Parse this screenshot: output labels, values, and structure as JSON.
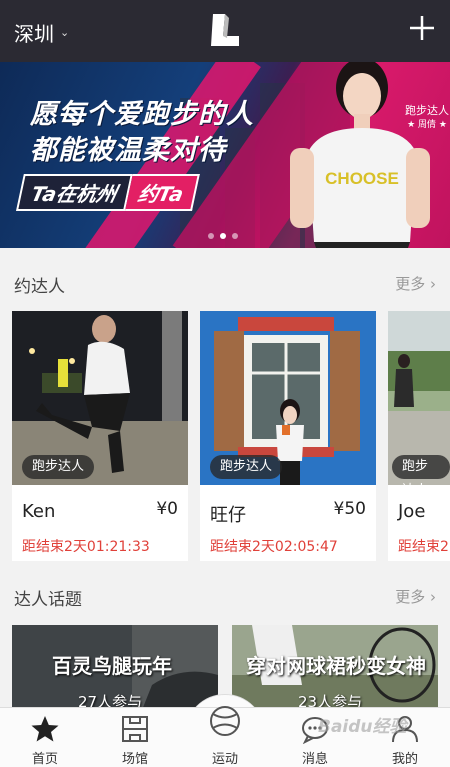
{
  "header": {
    "city": "深圳",
    "logo_icon": "brand-logo-icon",
    "add_icon": "plus-icon"
  },
  "banner": {
    "line1": "愿每个爱跑步的人",
    "line2": "都能被温柔对待",
    "tag_left": "Ta在杭州",
    "tag_right": "约Ta",
    "runner_label": "跑步达人",
    "runner_name": "★ 周倩 ★",
    "shirt_text": "CHOOSE",
    "carousel_active_index": 2,
    "carousel_count": 3
  },
  "section_people": {
    "title": "约达人",
    "more": "更多 ›"
  },
  "people": [
    {
      "badge": "跑步达人",
      "name": "Ken",
      "price": "¥0",
      "timer": "距结束2天01:21:33"
    },
    {
      "badge": "跑步达人",
      "name": "旺仔",
      "price": "¥50",
      "timer": "距结束2天02:05:47"
    },
    {
      "badge": "跑步达人",
      "name": "Joe",
      "price": "",
      "timer": "距结束2"
    }
  ],
  "section_topics": {
    "title": "达人话题",
    "more": "更多 ›"
  },
  "topics": [
    {
      "title": "百灵鸟腿玩年",
      "count": "27人参与"
    },
    {
      "title": "穿对网球裙秒变女神",
      "count": "23人参与"
    }
  ],
  "nav": [
    {
      "label": "首页",
      "icon": "star-icon",
      "active": true
    },
    {
      "label": "场馆",
      "icon": "venue-icon",
      "active": false
    },
    {
      "label": "运动",
      "icon": "ball-icon",
      "active": false
    },
    {
      "label": "消息",
      "icon": "message-icon",
      "active": false
    },
    {
      "label": "我的",
      "icon": "person-icon",
      "active": false
    }
  ],
  "watermark": "Baidu经验",
  "colors": {
    "header_bg": "#2b2a33",
    "accent_red": "#e0413a",
    "banner_pink": "#e3166d"
  }
}
